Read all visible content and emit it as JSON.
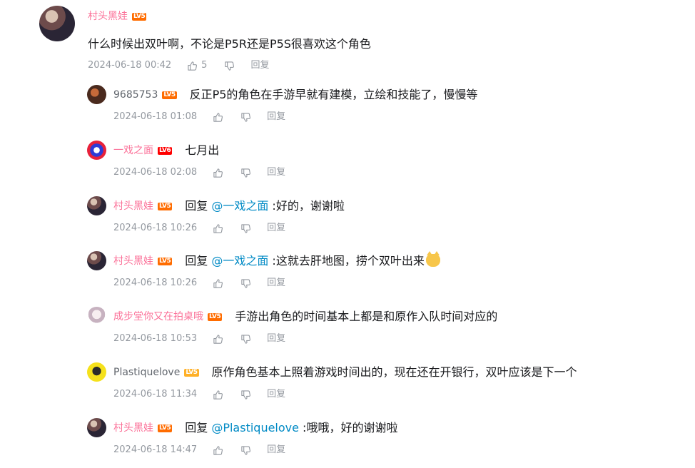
{
  "main": {
    "username": "村头黑娃",
    "level": "LV5",
    "text": "什么时候出双叶啊，不论是P5R还是P5S很喜欢这个角色",
    "time": "2024-06-18 00:42",
    "likes": "5",
    "reply_label": "回复"
  },
  "replies": [
    {
      "username": "9685753",
      "level": "LV5",
      "text": "反正P5的角色在手游早就有建模，立绘和技能了，慢慢等",
      "time": "2024-06-18 01:08",
      "reply_label": "回复"
    },
    {
      "username": "一戏之面",
      "level": "LV6",
      "text": "七月出",
      "time": "2024-06-18 02:08",
      "reply_label": "回复"
    },
    {
      "username": "村头黑娃",
      "level": "LV5",
      "prefix": "回复 ",
      "at": "@一戏之面",
      "text": " :好的，谢谢啦",
      "time": "2024-06-18 10:26",
      "reply_label": "回复"
    },
    {
      "username": "村头黑娃",
      "level": "LV5",
      "prefix": "回复 ",
      "at": "@一戏之面",
      "text": " :这就去肝地图，捞个双叶出来",
      "emoji": "cat-emoji",
      "time": "2024-06-18 10:26",
      "reply_label": "回复"
    },
    {
      "username": "成步堂你又在拍桌哦",
      "level": "LV5",
      "text": "手游出角色的时间基本上都是和原作入队时间对应的",
      "time": "2024-06-18 10:53",
      "reply_label": "回复"
    },
    {
      "username": "Plastiquelove",
      "level": "LV5",
      "text": "原作角色基本上照着游戏时间出的，现在还在开银行，双叶应该是下一个",
      "time": "2024-06-18 11:34",
      "reply_label": "回复"
    },
    {
      "username": "村头黑娃",
      "level": "LV5",
      "prefix": "回复 ",
      "at": "@Plastiquelove",
      "text": " :哦哦，好的谢谢啦",
      "time": "2024-06-18 14:47",
      "reply_label": "回复"
    }
  ],
  "colors": {
    "vip_name": "#fb7299",
    "at_link": "#008ac5",
    "meta": "#9499a0",
    "level_badge": "#ff6c00"
  }
}
